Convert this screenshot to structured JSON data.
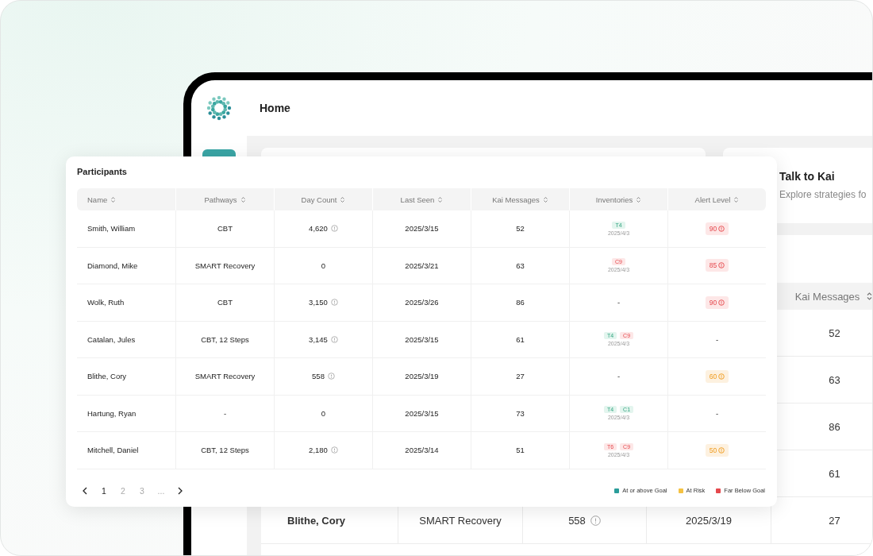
{
  "app": {
    "header": {
      "title": "Home"
    },
    "kai_card": {
      "title": "Talk to Kai",
      "subtitle": "Explore strategies fo"
    },
    "table": {
      "visible_header": "Kai Messages",
      "rows": [
        {
          "kai_messages": "52"
        },
        {
          "kai_messages": "63"
        },
        {
          "kai_messages": "86"
        },
        {
          "kai_messages": "61"
        },
        {
          "name": "Blithe, Cory",
          "pathways": "SMART Recovery",
          "day_count": "558",
          "info": true,
          "last_seen": "2025/3/19",
          "kai_messages": "27"
        }
      ]
    }
  },
  "participants": {
    "title": "Participants",
    "columns": [
      "Name",
      "Pathways",
      "Day Count",
      "Last Seen",
      "Kai Messages",
      "Inventories",
      "Alert Level"
    ],
    "rows": [
      {
        "name": "Smith, William",
        "pathways": "CBT",
        "day_count": "4,620",
        "info": true,
        "last_seen": "2025/3/15",
        "kai_messages": "52",
        "inventories": {
          "tags": [
            {
              "label": "T4",
              "kind": "good"
            }
          ],
          "date": "2025/4/3"
        },
        "alert": {
          "value": "90",
          "kind": "far_below"
        }
      },
      {
        "name": "Diamond, Mike",
        "pathways": "SMART Recovery",
        "day_count": "0",
        "info": false,
        "last_seen": "2025/3/21",
        "kai_messages": "63",
        "inventories": {
          "tags": [
            {
              "label": "C9",
              "kind": "bad"
            }
          ],
          "date": "2025/4/3"
        },
        "alert": {
          "value": "85",
          "kind": "far_below"
        }
      },
      {
        "name": "Wolk, Ruth",
        "pathways": "CBT",
        "day_count": "3,150",
        "info": true,
        "last_seen": "2025/3/26",
        "kai_messages": "86",
        "inventories_text": "-",
        "alert": {
          "value": "90",
          "kind": "far_below"
        }
      },
      {
        "name": "Catalan, Jules",
        "pathways": "CBT, 12 Steps",
        "day_count": "3,145",
        "info": true,
        "last_seen": "2025/3/15",
        "kai_messages": "61",
        "inventories": {
          "tags": [
            {
              "label": "T4",
              "kind": "good"
            },
            {
              "label": "C9",
              "kind": "bad"
            }
          ],
          "date": "2025/4/3"
        },
        "alert_text": "-"
      },
      {
        "name": "Blithe, Cory",
        "pathways": "SMART Recovery",
        "day_count": "558",
        "info": true,
        "last_seen": "2025/3/19",
        "kai_messages": "27",
        "inventories_text": "-",
        "alert": {
          "value": "60",
          "kind": "at_risk"
        }
      },
      {
        "name": "Hartung, Ryan",
        "pathways": "-",
        "day_count": "0",
        "info": false,
        "last_seen": "2025/3/15",
        "kai_messages": "73",
        "inventories": {
          "tags": [
            {
              "label": "T4",
              "kind": "good"
            },
            {
              "label": "C1",
              "kind": "good"
            }
          ],
          "date": "2025/4/3"
        },
        "alert_text": "-"
      },
      {
        "name": "Mitchell, Daniel",
        "pathways": "CBT, 12 Steps",
        "day_count": "2,180",
        "info": true,
        "last_seen": "2025/3/14",
        "kai_messages": "51",
        "inventories": {
          "tags": [
            {
              "label": "T6",
              "kind": "bad"
            },
            {
              "label": "C9",
              "kind": "bad"
            }
          ],
          "date": "2025/4/3"
        },
        "alert": {
          "value": "50",
          "kind": "at_risk"
        }
      }
    ],
    "pagination": {
      "pages": [
        {
          "label": "1",
          "selected": true
        },
        {
          "label": "2",
          "selected": false
        },
        {
          "label": "3",
          "selected": false
        },
        {
          "label": "...",
          "selected": false
        }
      ]
    },
    "legend": [
      {
        "label": "At or above Goal",
        "color": "#2a9d9a"
      },
      {
        "label": "At Risk",
        "color": "#f5c242"
      },
      {
        "label": "Far Below Goal",
        "color": "#e5484d"
      }
    ]
  }
}
